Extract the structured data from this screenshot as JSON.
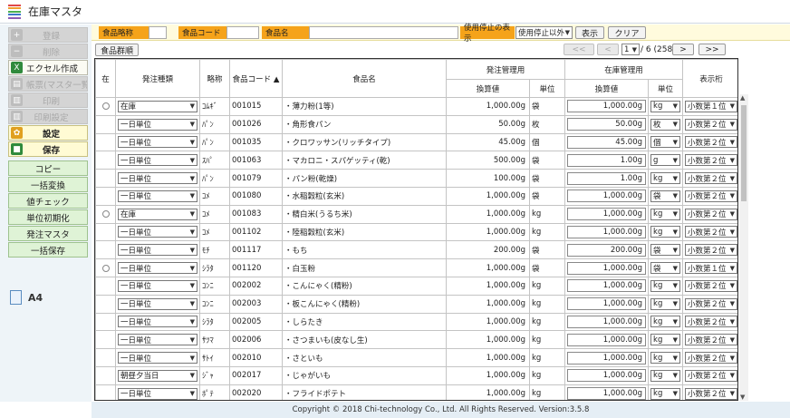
{
  "window": {
    "title": "在庫マスタ"
  },
  "sidebar": {
    "buttons": [
      {
        "label": "登録",
        "icon": "plus-icon",
        "state": "disabled",
        "color": "#bdbdbd"
      },
      {
        "label": "削除",
        "icon": "minus-icon",
        "state": "disabled",
        "color": "#bdbdbd"
      },
      {
        "label": "エクセル作成",
        "icon": "excel-icon",
        "state": "enabled",
        "color": "#2f8a3c"
      },
      {
        "label": "帳票(マスタ一覧表)",
        "icon": "print-icon",
        "state": "disabled",
        "color": "#bdbdbd"
      },
      {
        "label": "印刷",
        "icon": "printer-icon",
        "state": "disabled",
        "color": "#bdbdbd"
      },
      {
        "label": "印刷設定",
        "icon": "print-settings-icon",
        "state": "disabled",
        "color": "#bdbdbd"
      },
      {
        "label": "設定",
        "icon": "gear-icon",
        "state": "yellow",
        "color": "#e0a020"
      },
      {
        "label": "保存",
        "icon": "save-icon",
        "state": "yellow",
        "color": "#2f8a3c"
      }
    ],
    "green_buttons": [
      "コピー",
      "一括変換",
      "値チェック",
      "単位初期化",
      "発注マスタ",
      "一括保存"
    ],
    "paper_size": "A4"
  },
  "search": {
    "short_name_label": "食品略称",
    "code_label": "食品コード",
    "name_label": "食品名",
    "stop_label": "使用停止の表示",
    "stop_value": "使用停止以外",
    "show_button": "表示",
    "clear_button": "クリア"
  },
  "toolbar": {
    "group_button": "食品群順"
  },
  "pager": {
    "first": "<<",
    "prev": "<",
    "page": "1",
    "total": "/ 6 (258)",
    "next": ">",
    "last": ">>"
  },
  "table": {
    "headers": {
      "stock": "在",
      "order_type": "発注種類",
      "short": "略称",
      "code": "食品コード ▲",
      "name": "食品名",
      "order_mgmt": "発注管理用",
      "inv_mgmt": "在庫管理用",
      "display_digits": "表示桁",
      "conv": "換算値",
      "unit": "単位",
      "conv2": "換算値",
      "unit2": "単位"
    },
    "rows": [
      {
        "radio": true,
        "type": "在庫",
        "short": "ｺﾑｷﾞ",
        "code": "001015",
        "name": "・薄力粉(1等)",
        "conv": "1,000.00g",
        "unit": "袋",
        "inv": "1,000.00g",
        "inv_unit": "kg",
        "digits": "小数第１位"
      },
      {
        "radio": false,
        "type": "一日単位",
        "short": "ﾊﾟﾝ",
        "code": "001026",
        "name": "・角形食パン",
        "conv": "50.00g",
        "unit": "枚",
        "inv": "50.00g",
        "inv_unit": "枚",
        "digits": "小数第２位"
      },
      {
        "radio": false,
        "type": "一日単位",
        "short": "ﾊﾟﾝ",
        "code": "001035",
        "name": "・クロワッサン(リッチタイプ)",
        "conv": "45.00g",
        "unit": "個",
        "inv": "45.00g",
        "inv_unit": "個",
        "digits": "小数第２位"
      },
      {
        "radio": false,
        "type": "一日単位",
        "short": "ｽﾊﾟ",
        "code": "001063",
        "name": "・マカロニ・スパゲッティ(乾)",
        "conv": "500.00g",
        "unit": "袋",
        "inv": "1.00g",
        "inv_unit": "g",
        "digits": "小数第２位"
      },
      {
        "radio": false,
        "type": "一日単位",
        "short": "ﾊﾟﾝ",
        "code": "001079",
        "name": "・パン粉(乾燥)",
        "conv": "100.00g",
        "unit": "袋",
        "inv": "1.00g",
        "inv_unit": "kg",
        "digits": "小数第２位"
      },
      {
        "radio": false,
        "type": "一日単位",
        "short": "ｺﾒ",
        "code": "001080",
        "name": "・水稲穀粒(玄米)",
        "conv": "1,000.00g",
        "unit": "袋",
        "inv": "1,000.00g",
        "inv_unit": "袋",
        "digits": "小数第２位"
      },
      {
        "radio": true,
        "type": "在庫",
        "short": "ｺﾒ",
        "code": "001083",
        "name": "・精白米(うるち米)",
        "conv": "1,000.00g",
        "unit": "kg",
        "inv": "1,000.00g",
        "inv_unit": "kg",
        "digits": "小数第２位"
      },
      {
        "radio": false,
        "type": "一日単位",
        "short": "ｺﾒ",
        "code": "001102",
        "name": "・陸稲穀粒(玄米)",
        "conv": "1,000.00g",
        "unit": "kg",
        "inv": "1,000.00g",
        "inv_unit": "kg",
        "digits": "小数第２位"
      },
      {
        "radio": false,
        "type": "一日単位",
        "short": "ﾓﾁ",
        "code": "001117",
        "name": "・もち",
        "conv": "200.00g",
        "unit": "袋",
        "inv": "200.00g",
        "inv_unit": "袋",
        "digits": "小数第２位"
      },
      {
        "radio": true,
        "type": "一日単位",
        "short": "ｼﾗﾀ",
        "code": "001120",
        "name": "・白玉粉",
        "conv": "1,000.00g",
        "unit": "袋",
        "inv": "1,000.00g",
        "inv_unit": "袋",
        "digits": "小数第１位"
      },
      {
        "radio": false,
        "type": "一日単位",
        "short": "ｺﾝﾆ",
        "code": "002002",
        "name": "・こんにゃく(精粉)",
        "conv": "1,000.00g",
        "unit": "kg",
        "inv": "1,000.00g",
        "inv_unit": "kg",
        "digits": "小数第２位"
      },
      {
        "radio": false,
        "type": "一日単位",
        "short": "ｺﾝﾆ",
        "code": "002003",
        "name": "・板こんにゃく(精粉)",
        "conv": "1,000.00g",
        "unit": "kg",
        "inv": "1,000.00g",
        "inv_unit": "kg",
        "digits": "小数第２位"
      },
      {
        "radio": false,
        "type": "一日単位",
        "short": "ｼﾗﾀ",
        "code": "002005",
        "name": "・しらたき",
        "conv": "1,000.00g",
        "unit": "kg",
        "inv": "1,000.00g",
        "inv_unit": "kg",
        "digits": "小数第２位"
      },
      {
        "radio": false,
        "type": "一日単位",
        "short": "ｻﾂﾏ",
        "code": "002006",
        "name": "・さつまいも(皮なし生)",
        "conv": "1,000.00g",
        "unit": "kg",
        "inv": "1,000.00g",
        "inv_unit": "kg",
        "digits": "小数第２位"
      },
      {
        "radio": false,
        "type": "一日単位",
        "short": "ｻﾄｲ",
        "code": "002010",
        "name": "・さといも",
        "conv": "1,000.00g",
        "unit": "kg",
        "inv": "1,000.00g",
        "inv_unit": "kg",
        "digits": "小数第２位"
      },
      {
        "radio": false,
        "type": "朝昼夕当日",
        "short": "ｼﾞｬ",
        "code": "002017",
        "name": "・じゃがいも",
        "conv": "1,000.00g",
        "unit": "kg",
        "inv": "1,000.00g",
        "inv_unit": "kg",
        "digits": "小数第２位"
      },
      {
        "radio": false,
        "type": "一日単位",
        "short": "ﾎﾟﾃ",
        "code": "002020",
        "name": "・フライドポテト",
        "conv": "1,000.00g",
        "unit": "kg",
        "inv": "1,000.00g",
        "inv_unit": "kg",
        "digits": "小数第２位"
      }
    ]
  },
  "footer": {
    "copyright": "Copyright © 2018 Chi-technology Co., Ltd. All Rights Reserved. Version:3.5.8"
  },
  "colors": {
    "accent_orange": "#f5a31a",
    "search_bg": "#fffbdd",
    "green_btn": "#dff3d6",
    "footer_bg": "#e5eef5"
  }
}
